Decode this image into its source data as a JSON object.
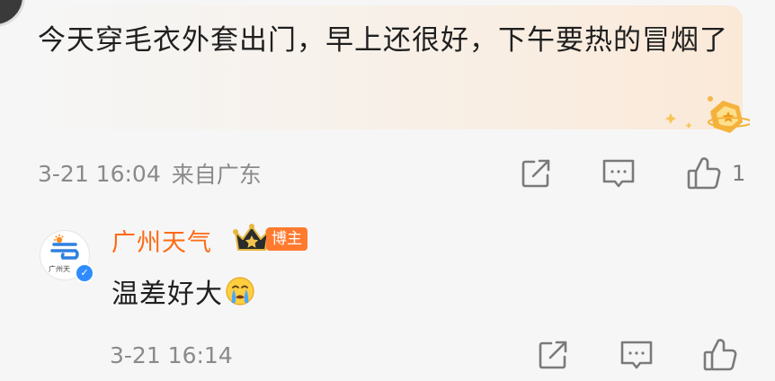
{
  "comment": {
    "text": "今天穿毛衣外套出门，早上还很好，下午要热的冒烟了",
    "time": "3-21 16:04",
    "location": "来自广东",
    "like_count": "1"
  },
  "reply": {
    "avatar_caption": "广州天",
    "author": "广州天气",
    "tag": "博主",
    "text": "温差好大",
    "emoji": "crying-face",
    "time": "3-21 16:14"
  },
  "colors": {
    "accent_orange": "#ff6a13",
    "meta_gray": "#8a8a8a",
    "verified_blue": "#2f8cff"
  }
}
